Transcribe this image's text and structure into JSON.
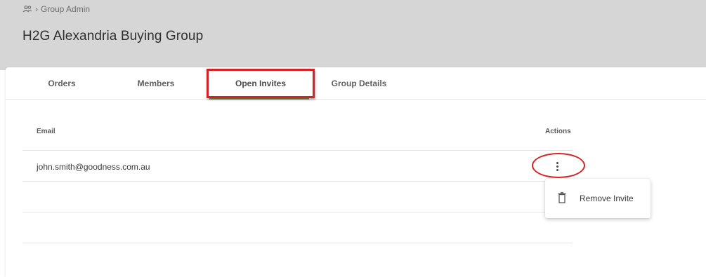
{
  "breadcrumb": {
    "icon": "group-icon",
    "separator": "›",
    "label": "Group Admin"
  },
  "page_title": "H2G Alexandria Buying Group",
  "tabs": [
    {
      "label": "Orders",
      "active": false
    },
    {
      "label": "Members",
      "active": false
    },
    {
      "label": "Open Invites",
      "active": true
    },
    {
      "label": "Group Details",
      "active": false
    }
  ],
  "table": {
    "headers": {
      "email": "Email",
      "actions": "Actions"
    },
    "rows": [
      {
        "email": "john.smith@goodness.com.au"
      }
    ]
  },
  "actions_menu": {
    "items": [
      {
        "icon": "trash-icon",
        "label": "Remove Invite"
      }
    ]
  },
  "colors": {
    "annotation_red": "#d62024",
    "active_tab_underline": "#7aa35a",
    "header_bg": "#d6d6d6"
  }
}
